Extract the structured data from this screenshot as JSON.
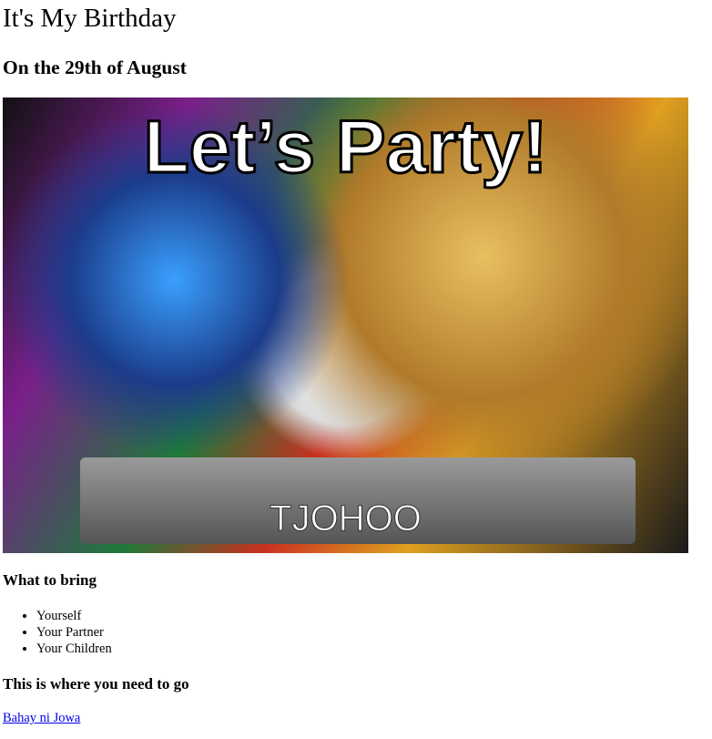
{
  "title": "It's My Birthday",
  "subtitle": "On the 29th of August",
  "image": {
    "caption_top": "Let’s Party!",
    "caption_bottom": "TJOHOO"
  },
  "bring": {
    "heading": "What to bring",
    "items": [
      "Yourself",
      "Your Partner",
      "Your Children"
    ]
  },
  "location": {
    "heading": "This is where you need to go",
    "link": "Bahay ni Jowa"
  }
}
